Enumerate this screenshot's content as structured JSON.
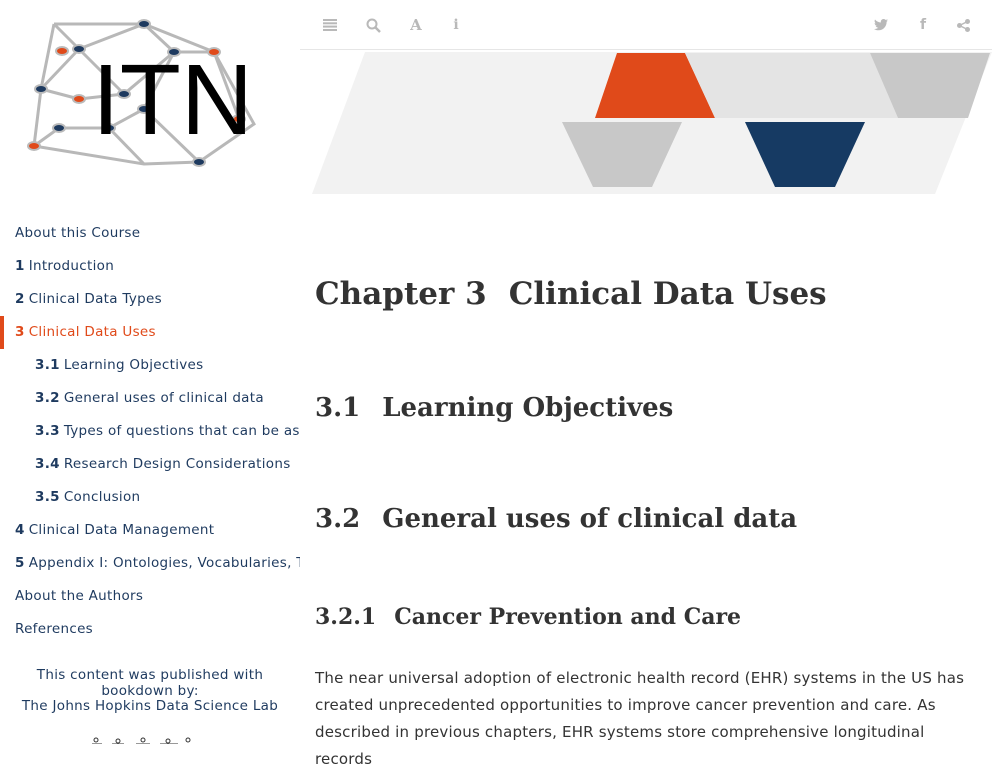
{
  "logo": {
    "text": "ITN"
  },
  "toolbar": {
    "toggle_icon": "list-icon",
    "search_icon": "search-icon",
    "font_icon": "font-icon",
    "info_icon": "info-icon",
    "twitter_icon": "twitter-icon",
    "facebook_icon": "facebook-icon",
    "share_icon": "share-icon"
  },
  "toc": [
    {
      "num": "",
      "label": "About this Course"
    },
    {
      "num": "1",
      "label": "Introduction"
    },
    {
      "num": "2",
      "label": "Clinical Data Types"
    },
    {
      "num": "3",
      "label": "Clinical Data Uses",
      "active": true
    },
    {
      "num": "3.1",
      "label": "Learning Objectives"
    },
    {
      "num": "3.2",
      "label": "General uses of clinical data"
    },
    {
      "num": "3.3",
      "label": "Types of questions that can be as…"
    },
    {
      "num": "3.4",
      "label": "Research Design Considerations"
    },
    {
      "num": "3.5",
      "label": "Conclusion"
    },
    {
      "num": "4",
      "label": "Clinical Data Management"
    },
    {
      "num": "5",
      "label": "Appendix I: Ontologies, Vocabularies, T…"
    },
    {
      "num": "",
      "label": "About the Authors"
    },
    {
      "num": "",
      "label": "References"
    }
  ],
  "published_by": "This content was published with bookdown by:",
  "lab_name": "The Johns Hopkins Data Science Lab",
  "chapter": {
    "num": "Chapter 3",
    "title": "Clinical Data Uses"
  },
  "sections": [
    {
      "num": "3.1",
      "title": "Learning Objectives"
    },
    {
      "num": "3.2",
      "title": "General uses of clinical data"
    }
  ],
  "subsection": {
    "num": "3.2.1",
    "title": "Cancer Prevention and Care"
  },
  "paragraph": {
    "line1": "The near universal adoption of electronic health record (EHR) systems in the US has",
    "line2": "created unprecedented opportunities to improve cancer prevention and care. As",
    "line3": "described in previous chapters, EHR systems store comprehensive longitudinal records"
  },
  "colors": {
    "accent": "#e04a1a",
    "navy": "#1e3a5f",
    "banner_gray": "#c8c8c8",
    "banner_orange": "#e04a1a",
    "banner_navy": "#163a63"
  }
}
